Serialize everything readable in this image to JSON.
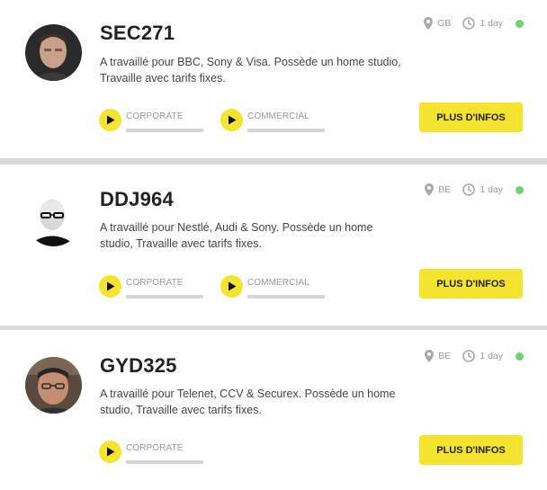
{
  "profiles": [
    {
      "id": "SEC271",
      "description": "A travaillé pour BBC, Sony & Visa. Possède un home studio, Travaille avec tarifs fixes.",
      "country": "GB",
      "last_active": "1 day",
      "online": true,
      "demos": [
        {
          "label": "CORPORATE"
        },
        {
          "label": "COMMERCIAL"
        }
      ],
      "button_label": "PLUS D'INFOS"
    },
    {
      "id": "DDJ964",
      "description": "A travaillé pour Nestlé, Audi & Sony. Possède un home studio, Travaille avec tarifs fixes.",
      "country": "BE",
      "last_active": "1 day",
      "online": true,
      "demos": [
        {
          "label": "CORPORATE"
        },
        {
          "label": "COMMERCIAL"
        }
      ],
      "button_label": "PLUS D'INFOS"
    },
    {
      "id": "GYD325",
      "description": "A travaillé pour Telenet, CCV & Securex. Possède un home studio, Travaille avec tarifs fixes.",
      "country": "BE",
      "last_active": "1 day",
      "online": true,
      "demos": [
        {
          "label": "CORPORATE"
        }
      ],
      "button_label": "PLUS D'INFOS"
    }
  ],
  "colors": {
    "accent_yellow": "#f4e32f",
    "online_green": "#6fd16f",
    "separator_gray": "#d9d9d9",
    "text_dark": "#222222",
    "text_muted": "#9a9a9a"
  },
  "icons": {
    "location": "location-pin-icon",
    "time": "clock-icon",
    "play": "play-icon",
    "status": "online-status-icon"
  }
}
